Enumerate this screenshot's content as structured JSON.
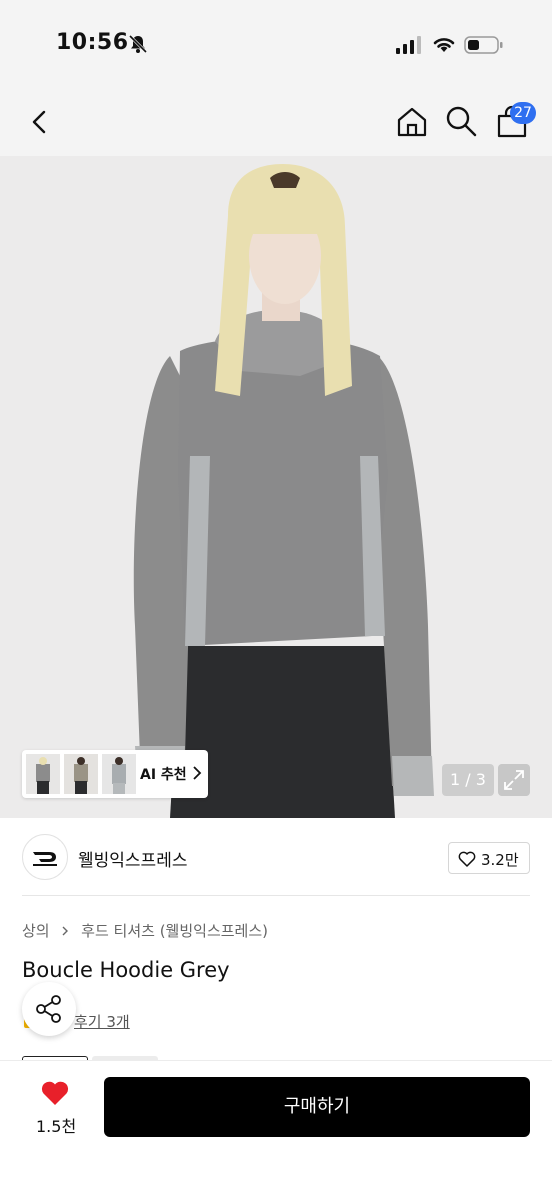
{
  "status_bar": {
    "time": "10:56"
  },
  "header": {
    "cart_count": "27"
  },
  "gallery": {
    "ai_label": "AI 추천",
    "counter": "1 / 3",
    "thumbnails": [
      "thumb-1",
      "thumb-2",
      "thumb-3"
    ]
  },
  "brand": {
    "name": "웰빙익스프레스",
    "like_count": "3.2만"
  },
  "breadcrumb": {
    "category": "상의",
    "subcategory": "후드 티셔츠 (웰빙익스프레스)"
  },
  "product": {
    "title": "Boucle Hoodie Grey",
    "review_text": "후기 3개"
  },
  "bottom": {
    "wish_count": "1.5천",
    "buy_label": "구매하기"
  },
  "colors": {
    "accent_blue": "#2f6ff0",
    "heart_red": "#e8202a",
    "buy_black": "#000000"
  }
}
